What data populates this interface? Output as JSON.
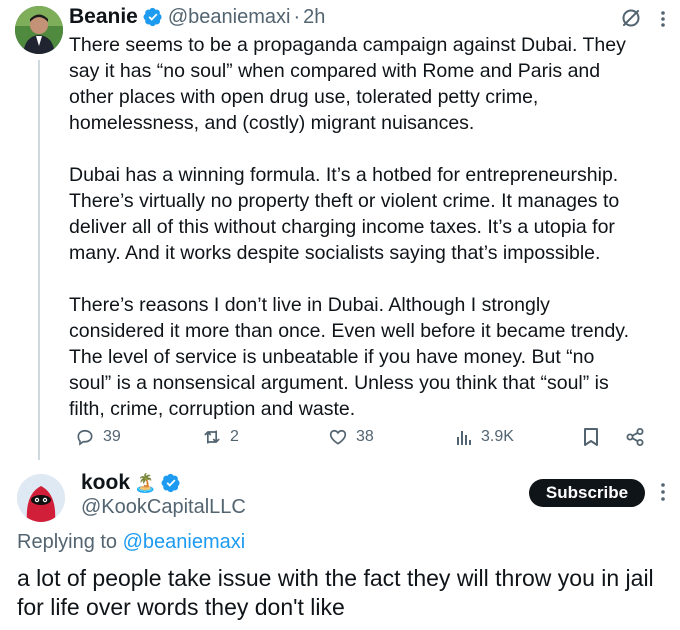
{
  "tweet": {
    "author_name": "Beanie",
    "handle": "@beaniemaxi",
    "separator": "·",
    "time": "2h",
    "paragraphs": [
      "There seems to be a propaganda campaign against Dubai. They\nsay it has “no soul” when compared with Rome and Paris and\nother places with open drug use, tolerated petty crime,\nhomelessness, and (costly) migrant nuisances.",
      "Dubai has a winning formula. It’s a hotbed for entrepreneurship.\nThere’s virtually no property theft or violent crime. It manages to\ndeliver all of this without charging income taxes. It’s a utopia for\nmany. And it works despite socialists saying that’s impossible.",
      "There’s reasons I don’t live in Dubai. Although I strongly\nconsidered it more than once. Even well before it became trendy.\nThe level of service is unbeatable if you have money. But “no\nsoul” is a nonsensical argument. Unless you think that “soul” is\nfilth, crime, corruption and waste."
    ],
    "stats": {
      "replies": "39",
      "reposts": "2",
      "likes": "38",
      "views": "3.9K"
    }
  },
  "reply": {
    "author_name": "kook",
    "name_emoji": "🏝️",
    "handle": "@KookCapitalLLC",
    "subscribe_label": "Subscribe",
    "replying_prefix": "Replying to",
    "replying_to": "@beaniemaxi",
    "text": "a lot of people take issue with the fact they will throw you in jail for life over words they don't like"
  },
  "colors": {
    "verified_blue": "#1d9bf0",
    "muted_text": "#536471",
    "text": "#0f1419",
    "link": "#1d9bf0"
  },
  "icons": {
    "verified": "verified-badge-icon",
    "grok": "grok-icon",
    "more": "more-options-icon",
    "reply": "reply-icon",
    "repost": "repost-icon",
    "like": "heart-icon",
    "views": "analytics-icon",
    "bookmark": "bookmark-icon",
    "share": "share-icon"
  }
}
